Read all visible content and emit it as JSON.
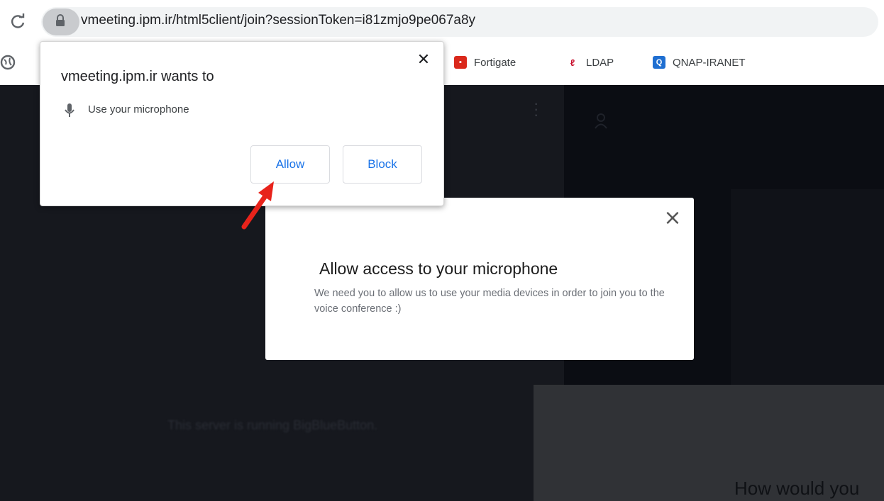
{
  "browser": {
    "url": "vmeeting.ipm.ir/html5client/join?sessionToken=i81zmjo9pe067a8y",
    "bookmarks": [
      {
        "label": "Fortigate",
        "icon": "fortigate-icon",
        "color": "#da291c"
      },
      {
        "label": "LDAP",
        "icon": "ldap-icon",
        "color": "#c8102e"
      },
      {
        "label": "QNAP-IRANET",
        "icon": "qnap-icon",
        "color": "#1f6fd1"
      }
    ]
  },
  "permission_popup": {
    "title": "vmeeting.ipm.ir wants to",
    "item": "Use your microphone",
    "allow_label": "Allow",
    "block_label": "Block"
  },
  "app_modal": {
    "title": "Allow access to your microphone",
    "description": "We need you to allow us to use your media devices in order to join you to the voice conference :)"
  },
  "background": {
    "help_text": "This server is running BigBlueButton.",
    "bottom_text": "How would you"
  },
  "colors": {
    "accent": "#1a73e8",
    "arrow": "#e8231b",
    "page_dark": "#0b0d13"
  }
}
